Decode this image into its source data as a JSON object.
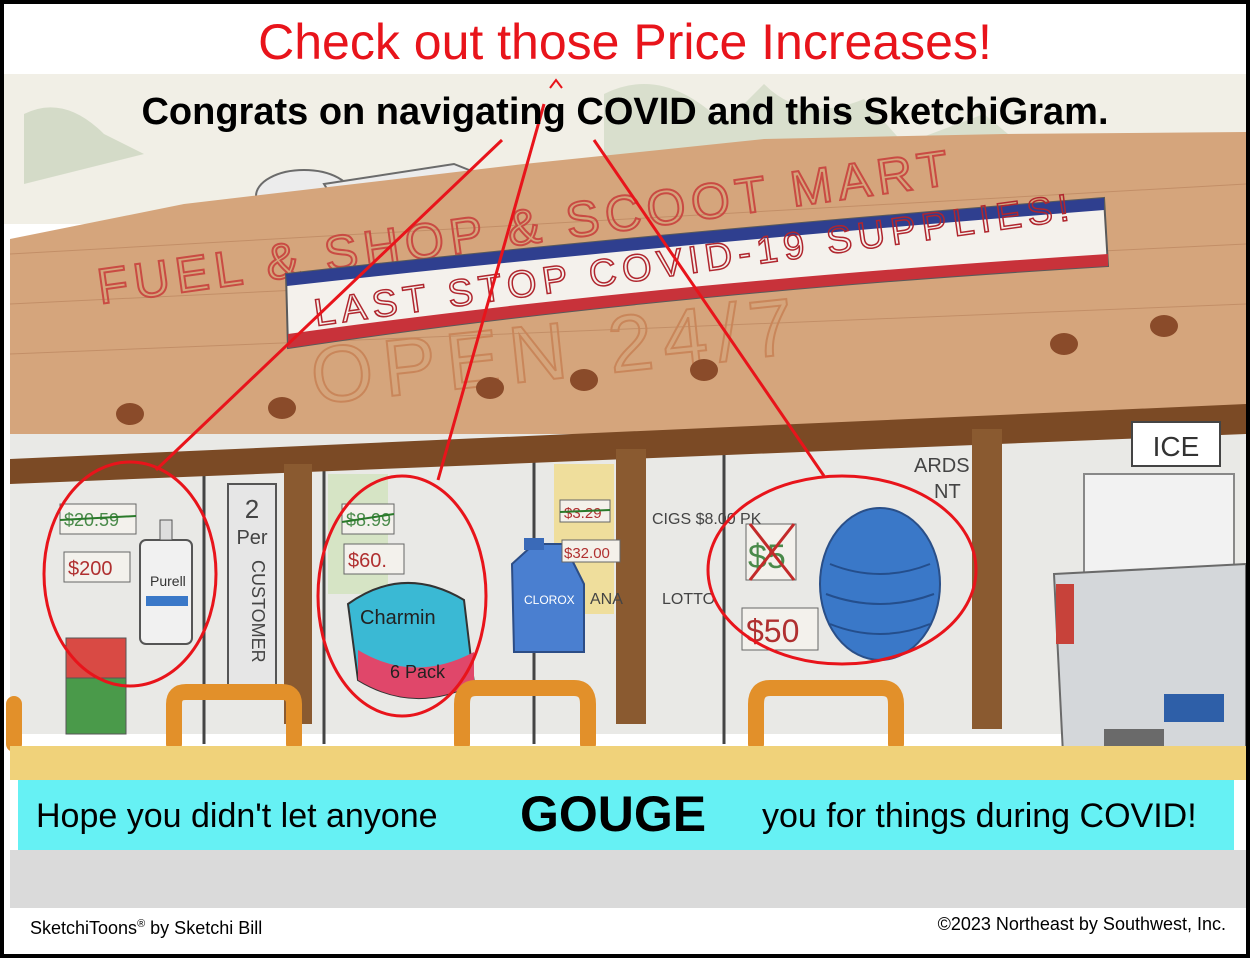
{
  "header": {
    "headline": "Check out those Price Increases!",
    "subheadline": "Congrats on navigating COVID and this SketchiGram."
  },
  "store": {
    "sign_name": "FUEL & SHOP & SCOOT MART",
    "hours": "OPEN 24/7",
    "banner": "LAST STOP COVID-19 SUPPLIES!",
    "ice_sign": "ICE",
    "vertical_sign": [
      "2",
      "Per",
      "CUSTOMER"
    ],
    "window_signs": {
      "cigs": "CIGS $8.00 PK",
      "lotto": "LOTTO",
      "bleach_price_old": "$3.29",
      "bleach_price_new": "$32.00",
      "cards": "ARDS",
      "ant": "NT",
      "ana": "ANA"
    }
  },
  "callouts": [
    {
      "item": "Purell",
      "old_price": "$20.59",
      "new_price": "$200"
    },
    {
      "item": "Charmin",
      "detail": "6 Pack",
      "old_price": "$8.99",
      "new_price": "$60."
    },
    {
      "item": "mask",
      "old_price": "$5",
      "new_price": "$50"
    }
  ],
  "products": {
    "bleach_label": "CLOROX"
  },
  "bottom_banner": {
    "left": "Hope you didn't let anyone",
    "emphasis": "GOUGE",
    "right": "you for things during COVID!"
  },
  "footer": {
    "brand": "SketchiToons",
    "brand_mark": "®",
    "byline": " by Sketchi Bill",
    "copyright": "©2023 Northeast by Southwest, Inc."
  },
  "colors": {
    "red": "#e8141b",
    "cyan_banner": "#66f1f4",
    "roof": "#c9956a",
    "pillar": "#8a5a30",
    "bollard": "#e2902a",
    "mask": "#3a78c8"
  }
}
